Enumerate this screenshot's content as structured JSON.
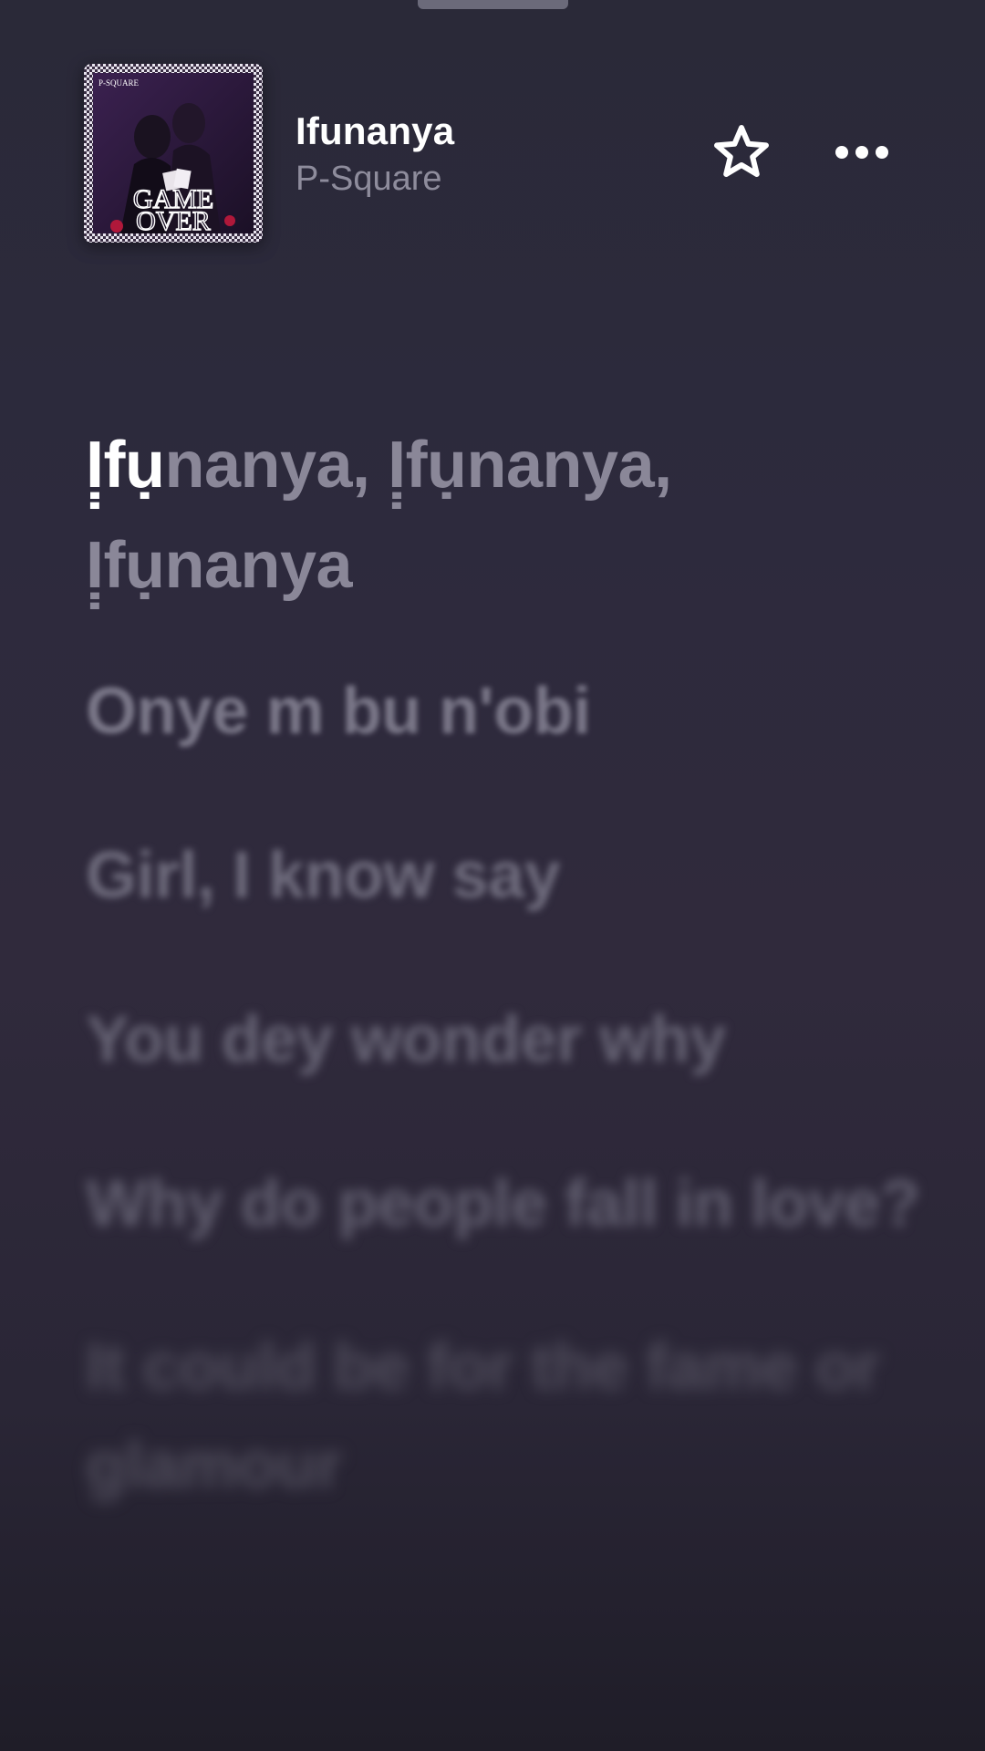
{
  "track": {
    "title": "Ifunanya",
    "artist": "P-Square"
  },
  "artwork": {
    "band_text": "P-SQUARE",
    "album_line1": "GAME",
    "album_line2": "OVER"
  },
  "icons": {
    "favorite": "star-icon",
    "more": "ellipsis-icon"
  },
  "lyrics": {
    "active": {
      "sung": "Ị̣fụ",
      "unsung": "nanya, Ị̣fụnanya, Ị̣fụnanya"
    },
    "lines": [
      "Onye m bu n'obi",
      "Girl, I know say",
      "You dey wonder why",
      "Why do people fall in love?",
      "It could be for the fame or glamour"
    ]
  },
  "colors": {
    "background": "#2c2a3a",
    "active_text": "#ffffff",
    "inactive_text": "#8a8798"
  }
}
